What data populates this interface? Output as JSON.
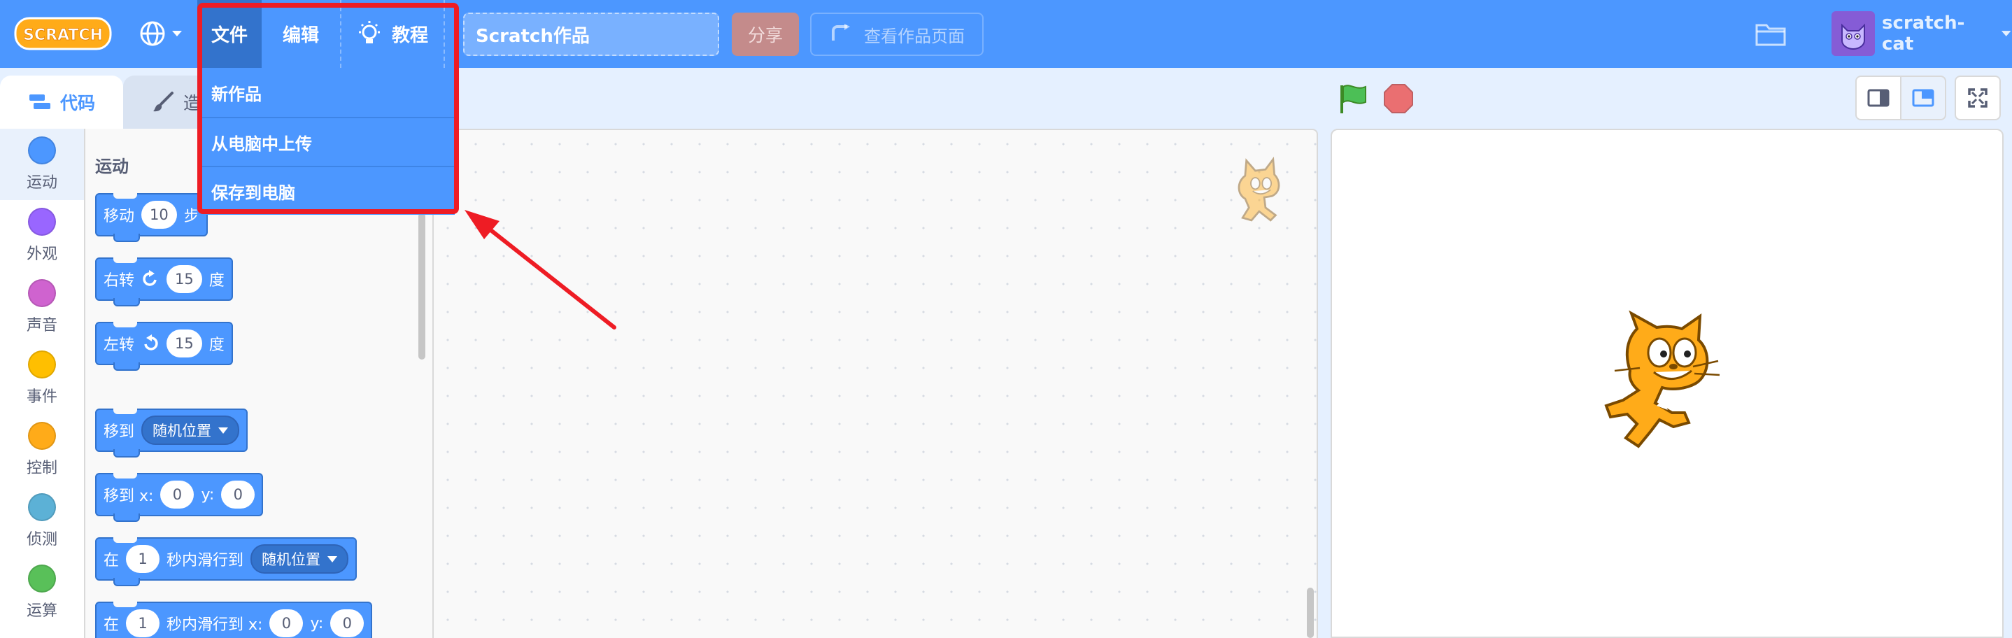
{
  "menubar": {
    "logo_text": "SCRATCH",
    "menus": {
      "file": "文件",
      "edit": "编辑",
      "tutorials": "教程"
    },
    "project_title": "Scratch作品",
    "share_label": "分享",
    "see_project_page_label": "查看作品页面",
    "username": "scratch-cat"
  },
  "file_menu": {
    "items": [
      "新作品",
      "从电脑中上传",
      "保存到电脑"
    ]
  },
  "tabs": {
    "code": "代码",
    "costumes": "造"
  },
  "categories": [
    {
      "label": "运动",
      "color": "#4c97ff"
    },
    {
      "label": "外观",
      "color": "#9966ff"
    },
    {
      "label": "声音",
      "color": "#cf63cf"
    },
    {
      "label": "事件",
      "color": "#ffbf00"
    },
    {
      "label": "控制",
      "color": "#ffab19"
    },
    {
      "label": "侦测",
      "color": "#5cb1d6"
    },
    {
      "label": "运算",
      "color": "#59c059"
    }
  ],
  "palette": {
    "section_title": "运动",
    "blocks": {
      "move": {
        "prefix": "移动",
        "value": "10",
        "suffix": "步"
      },
      "turn_right": {
        "prefix": "右转",
        "value": "15",
        "suffix": "度"
      },
      "turn_left": {
        "prefix": "左转",
        "value": "15",
        "suffix": "度"
      },
      "goto_menu": {
        "prefix": "移到",
        "option": "随机位置"
      },
      "goto_xy": {
        "prefix": "移到 x:",
        "x": "0",
        "y_label": "y:",
        "y": "0"
      },
      "glide_menu": {
        "prefix": "在",
        "secs": "1",
        "middle": "秒内滑行到",
        "option": "随机位置"
      },
      "glide_xy": {
        "prefix": "在",
        "secs": "1",
        "middle": "秒内滑行到 x:",
        "x": "0",
        "y_label": "y:",
        "y": "0"
      }
    }
  },
  "colors": {
    "menubar": "#4c97ff",
    "menu_active": "#3373cc",
    "highlight": "#ee1c24",
    "motion": "#4c97ff"
  }
}
